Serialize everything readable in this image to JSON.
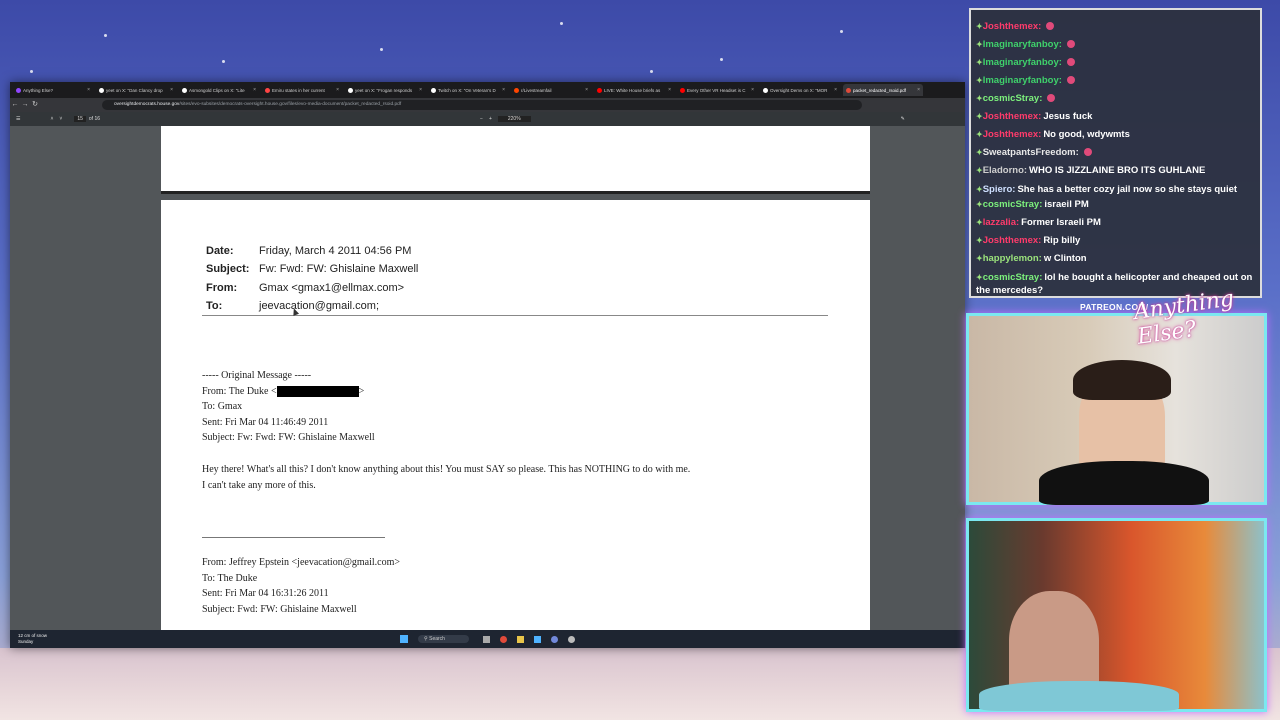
{
  "browser": {
    "tabs": [
      {
        "label": "Anything Else?",
        "color": "#9146ff"
      },
      {
        "label": "yeet on X: \"Dan Clancy drop",
        "color": "#ffffff"
      },
      {
        "label": "Asmongold Clips on X: \"Lite",
        "color": "#ffffff"
      },
      {
        "label": "Emiru states in her current",
        "color": "#ff4444"
      },
      {
        "label": "yeet on X: \"Frogan responds",
        "color": "#ffffff"
      },
      {
        "label": "Twitch on X: \"On Veteran's D",
        "color": "#ffffff"
      },
      {
        "label": "r/Livestreamfail",
        "color": "#ff4500"
      },
      {
        "label": "LIVE: White House briefs as",
        "color": "#ff0000"
      },
      {
        "label": "Every Other VR Headset is C",
        "color": "#ff0000"
      },
      {
        "label": "Oversight Dems on X: \"MOR",
        "color": "#ffffff"
      },
      {
        "label": "packet_redacted_rsoid.pdf",
        "color": "#e04a3a"
      }
    ],
    "url_domain": "oversightdemocrats.house.gov",
    "url_path": "/sites/evo-subsites/democrats-oversight.house.gov/files/evo-media-document/packet_redacted_rsoid.pdf",
    "pdf": {
      "page": "15",
      "of": "of 16",
      "zoom": "220%"
    }
  },
  "email": {
    "date_label": "Date:",
    "date": "Friday, March 4 2011 04:56 PM",
    "subject_label": "Subject:",
    "subject": "Fw: Fwd: FW: Ghislaine Maxwell",
    "from_label": "From:",
    "from": "Gmax <gmax1@ellmax.com>",
    "to_label": "To:",
    "to": "jeevacation@gmail.com;"
  },
  "original": {
    "header": "----- Original Message -----",
    "from": "From: The Duke <",
    "from_end": ">",
    "to": "To: Gmax",
    "sent": "Sent: Fri Mar 04 11:46:49 2011",
    "subject": "Subject: Fw: Fwd: FW: Ghislaine Maxwell",
    "body1": "Hey there! What's all this? I don't know anything about this! You must SAY  so please. This has NOTHING to do with me.",
    "body2": "I can't take any more of this."
  },
  "forward": {
    "from": "From: Jeffrey Epstein <jeevacation@gmail.com>",
    "to": "To: The Duke",
    "sent": "Sent: Fri Mar 04 16:31:26 2011",
    "subject": "Subject: Fwd: FW: Ghislaine Maxwell"
  },
  "chat": [
    {
      "name": "Joshthemex:",
      "color": "#ff3b6b",
      "text": ""
    },
    {
      "name": "Imaginaryfanboy:",
      "color": "#3fd16b",
      "text": ""
    },
    {
      "name": "Imaginaryfanboy:",
      "color": "#3fd16b",
      "text": ""
    },
    {
      "name": "Imaginaryfanboy:",
      "color": "#3fd16b",
      "text": ""
    },
    {
      "name": "cosmicStray:",
      "color": "#7cf07c",
      "text": ""
    },
    {
      "name": "Joshthemex:",
      "color": "#ff3b6b",
      "text": "Jesus fuck"
    },
    {
      "name": "Joshthemex:",
      "color": "#ff3b6b",
      "text": "No good, wdywmts"
    },
    {
      "name": "SweatpantsFreedom:",
      "color": "#e8e8e8",
      "text": ""
    },
    {
      "name": "Eladorno:",
      "color": "#cfcfcf",
      "text": "WHO IS JIZZLAINE BRO ITS GUHLANE"
    },
    {
      "name": "Spiero:",
      "color": "#cfe0ff",
      "text": "She has a better cozy jail now so she stays quiet"
    },
    {
      "name": "cosmicStray:",
      "color": "#7cf07c",
      "text": "israeil PM"
    },
    {
      "name": "lazzalia:",
      "color": "#ff3b6b",
      "text": "Former Israeli PM"
    },
    {
      "name": "Joshthemex:",
      "color": "#ff3b6b",
      "text": "Rip billy"
    },
    {
      "name": "happylemon:",
      "color": "#9be37c",
      "text": "w Clinton"
    },
    {
      "name": "cosmicStray:",
      "color": "#7cf07c",
      "text": "lol he bought a helicopter and cheaped out on the mercedes?"
    }
  ],
  "overlay": {
    "patreon": "PATREON.COM/",
    "logo": "Anything Else?"
  },
  "taskbar": {
    "search": "Search",
    "weather_line1": "12 cm of snow",
    "weather_line2": "Sunday"
  }
}
